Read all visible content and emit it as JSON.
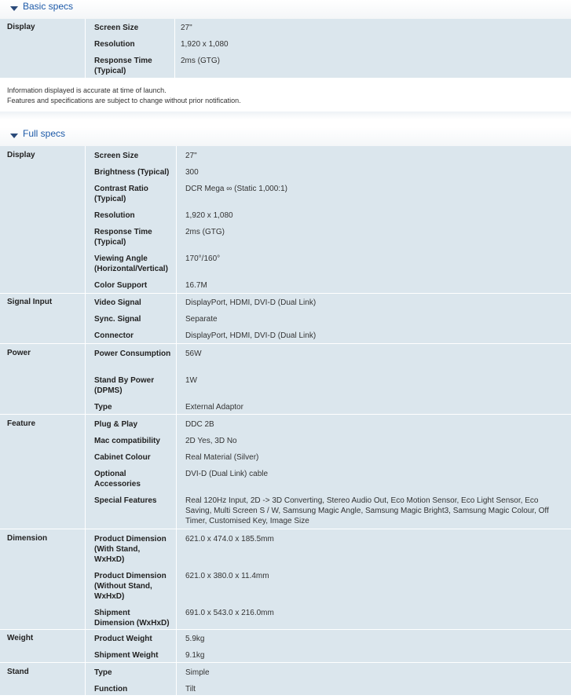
{
  "basic": {
    "title": "Basic specs",
    "groups": [
      {
        "category": "Display",
        "rows": [
          {
            "label": "Screen Size",
            "value": "27\""
          },
          {
            "label": "Resolution",
            "value": "1,920 x 1,080"
          },
          {
            "label": "Response Time (Typical)",
            "value": "2ms (GTG)"
          }
        ]
      }
    ]
  },
  "notice": {
    "line1": "Information displayed is accurate at time of launch.",
    "line2": "Features and specifications are subject to change without prior notification."
  },
  "full": {
    "title": "Full specs",
    "groups": [
      {
        "category": "Display",
        "rows": [
          {
            "label": "Screen Size",
            "value": "27\""
          },
          {
            "label": "Brightness (Typical)",
            "value": "300"
          },
          {
            "label": "Contrast Ratio (Typical)",
            "value": "DCR Mega ∞ (Static 1,000:1)"
          },
          {
            "label": "Resolution",
            "value": "1,920 x 1,080"
          },
          {
            "label": "Response Time (Typical)",
            "value": "2ms (GTG)"
          },
          {
            "label": "Viewing Angle (Horizontal/Vertical)",
            "value": "170°/160°"
          },
          {
            "label": "Color Support",
            "value": "16.7M"
          }
        ]
      },
      {
        "category": "Signal Input",
        "rows": [
          {
            "label": "Video Signal",
            "value": "DisplayPort, HDMI, DVI-D (Dual Link)"
          },
          {
            "label": "Sync. Signal",
            "value": "Separate"
          },
          {
            "label": "Connector",
            "value": "DisplayPort, HDMI, DVI-D (Dual Link)"
          }
        ]
      },
      {
        "category": "Power",
        "rows": [
          {
            "label": "Power Consumption",
            "value": "56W"
          },
          {
            "label": "Stand By Power (DPMS)",
            "value": "1W"
          },
          {
            "label": "Type",
            "value": "External Adaptor"
          }
        ]
      },
      {
        "category": "Feature",
        "rows": [
          {
            "label": "Plug & Play",
            "value": "DDC 2B"
          },
          {
            "label": "Mac compatibility",
            "value": "2D Yes, 3D No"
          },
          {
            "label": "Cabinet Colour",
            "value": "Real Material (Silver)"
          },
          {
            "label": "Optional Accessories",
            "value": "DVI-D (Dual Link) cable"
          },
          {
            "label": "Special Features",
            "value": "Real 120Hz Input, 2D -> 3D Converting, Stereo Audio Out, Eco Motion Sensor, Eco Light Sensor, Eco Saving, Multi Screen S / W, Samsung Magic Angle, Samsung Magic Bright3, Samsung Magic Colour, Off Timer, Customised Key, Image Size"
          }
        ]
      },
      {
        "category": "Dimension",
        "rows": [
          {
            "label": "Product Dimension (With Stand, WxHxD)",
            "value": "621.0 x 474.0 x 185.5mm"
          },
          {
            "label": "Product Dimension (Without Stand, WxHxD)",
            "value": "621.0 x 380.0 x 11.4mm"
          },
          {
            "label": "Shipment Dimension (WxHxD)",
            "value": "691.0 x 543.0 x 216.0mm"
          }
        ]
      },
      {
        "category": "Weight",
        "rows": [
          {
            "label": "Product Weight",
            "value": "5.9kg"
          },
          {
            "label": "Shipment Weight",
            "value": "9.1kg"
          }
        ]
      },
      {
        "category": "Stand",
        "rows": [
          {
            "label": "Type",
            "value": "Simple"
          },
          {
            "label": "Function",
            "value": "Tilt"
          }
        ]
      }
    ]
  }
}
